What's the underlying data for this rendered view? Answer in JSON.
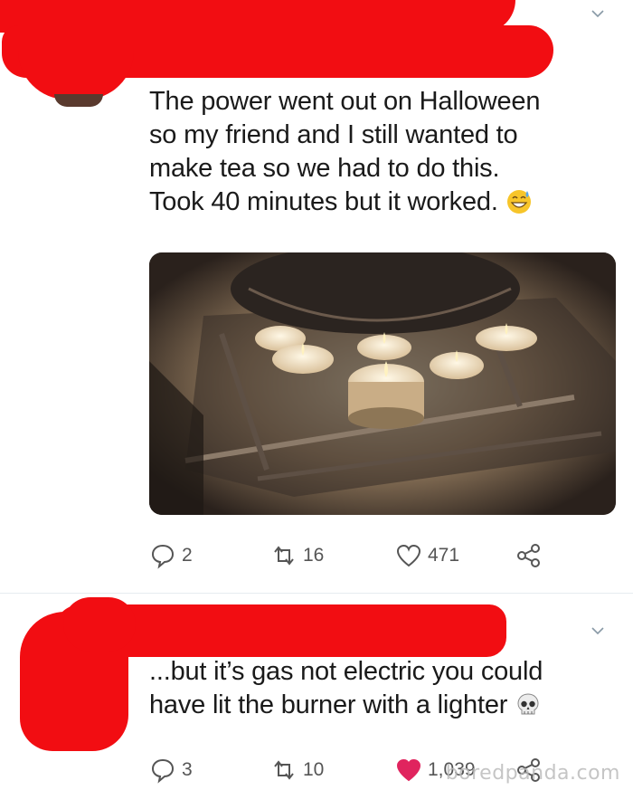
{
  "tweet1": {
    "lines": [
      "The power went out on Halloween",
      "so my friend and I still wanted to",
      "make tea so we had to do this.",
      "Took 40 minutes but it worked."
    ],
    "emoji": "grinning-sweat-emoji",
    "replies": "2",
    "retweets": "16",
    "likes": "471"
  },
  "tweet2": {
    "lines": [
      "...but it’s gas not electric you could",
      "have lit the burner with a lighter"
    ],
    "emoji": "skull-emoji",
    "replies": "3",
    "retweets": "10",
    "likes": "1,039",
    "liked": true
  },
  "watermark": "boredpanda.com",
  "colors": {
    "redaction": "#f20d12",
    "liked_heart": "#e0245e",
    "icon_gray": "#657786"
  }
}
